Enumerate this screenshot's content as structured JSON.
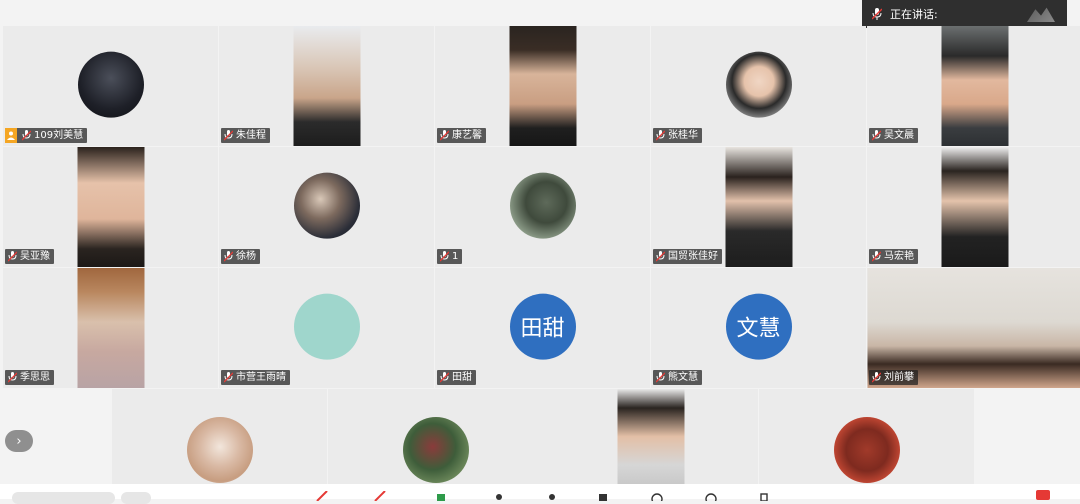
{
  "speaking": {
    "label": "正在讲话:"
  },
  "tiles": [
    {
      "name": "109刘美慧",
      "host": true,
      "kind": "avatar"
    },
    {
      "name": "朱佳程",
      "kind": "photo"
    },
    {
      "name": "康艺馨",
      "kind": "photo"
    },
    {
      "name": "张桂华",
      "kind": "avatar"
    },
    {
      "name": "吴文晨",
      "kind": "photo"
    },
    {
      "name": "吴亚豫",
      "kind": "photo"
    },
    {
      "name": "徐杨",
      "kind": "avatar"
    },
    {
      "name": "1",
      "kind": "avatar"
    },
    {
      "name": "国贸张佳好",
      "kind": "photo"
    },
    {
      "name": "马宏艳",
      "kind": "photo"
    },
    {
      "name": "季思思",
      "kind": "photo"
    },
    {
      "name": "市营王雨晴",
      "kind": "avatar-blank",
      "color": "#9fd6cc"
    },
    {
      "name": "田甜",
      "kind": "avatar-text",
      "text": "田甜",
      "color": "#2f6fc0"
    },
    {
      "name": "熊文慧",
      "kind": "avatar-text",
      "text": "文慧",
      "color": "#2f6fc0"
    },
    {
      "name": "刘前攀",
      "kind": "video-wide"
    }
  ],
  "strip": {
    "scroll_icon": "chevron-right-icon",
    "scroll_glyph": "›"
  },
  "colors": {
    "host_badge": "#f5a623",
    "end_button": "#e53935"
  }
}
